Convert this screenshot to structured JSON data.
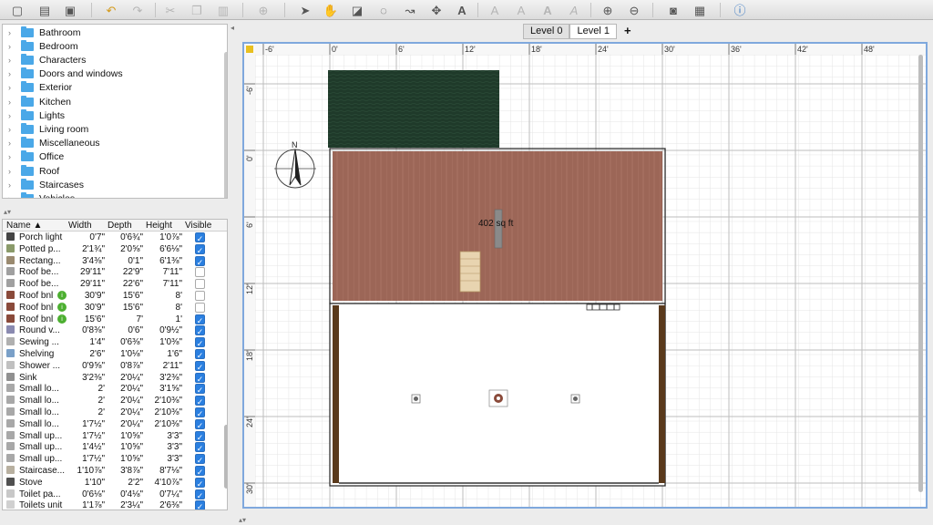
{
  "toolbar": {
    "icons": [
      "new-home-icon",
      "open-icon",
      "save-icon",
      "undo-icon",
      "redo-icon",
      "cut-icon",
      "copy-icon",
      "paste-icon",
      "add-furniture-icon",
      "select-icon",
      "pan-icon",
      "create-walls-icon",
      "create-rooms-icon",
      "create-polylines-icon",
      "create-dimensions-icon",
      "add-text-icon",
      "text-style-icons",
      "zoom-in-icon",
      "zoom-out-icon",
      "create-photo-icon",
      "create-video-icon",
      "help-icon"
    ]
  },
  "catalog": {
    "categories": [
      "Bathroom",
      "Bedroom",
      "Characters",
      "Doors and windows",
      "Exterior",
      "Kitchen",
      "Lights",
      "Living room",
      "Miscellaneous",
      "Office",
      "Roof",
      "Staircases",
      "Vehicles"
    ]
  },
  "furniture_table": {
    "headers": {
      "name": "Name ▲",
      "width": "Width",
      "depth": "Depth",
      "height": "Height",
      "visible": "Visible"
    },
    "rows": [
      {
        "name": "Porch light",
        "width": "0'7\"",
        "depth": "0'6¾\"",
        "height": "1'0⅞\"",
        "visible": true,
        "icon": "#444444"
      },
      {
        "name": "Potted p...",
        "width": "2'1¾\"",
        "depth": "2'0⅝\"",
        "height": "6'6⅛\"",
        "visible": true,
        "icon": "#8a9a6a"
      },
      {
        "name": "Rectang...",
        "width": "3'4⅜\"",
        "depth": "0'1\"",
        "height": "6'1⅜\"",
        "visible": true,
        "icon": "#9a8a70"
      },
      {
        "name": "Roof be...",
        "width": "29'11\"",
        "depth": "22'9\"",
        "height": "7'11\"",
        "visible": false,
        "icon": "#a0a0a0"
      },
      {
        "name": "Roof be...",
        "width": "29'11\"",
        "depth": "22'6\"",
        "height": "7'11\"",
        "visible": false,
        "icon": "#a0a0a0"
      },
      {
        "name": "Roof bnl",
        "width": "30'9\"",
        "depth": "15'6\"",
        "height": "8'",
        "visible": false,
        "icon": "#8a4a3a",
        "badge": true
      },
      {
        "name": "Roof bnl",
        "width": "30'9\"",
        "depth": "15'6\"",
        "height": "8'",
        "visible": false,
        "icon": "#8a4a3a",
        "badge": true
      },
      {
        "name": "Roof bnl",
        "width": "15'6\"",
        "depth": "7'",
        "height": "1'",
        "visible": true,
        "icon": "#8a4a3a",
        "badge": true
      },
      {
        "name": "Round v...",
        "width": "0'8⅜\"",
        "depth": "0'6\"",
        "height": "0'9½\"",
        "visible": true,
        "icon": "#8a8ab0"
      },
      {
        "name": "Sewing ...",
        "width": "1'4\"",
        "depth": "0'6⅜\"",
        "height": "1'0⅜\"",
        "visible": true,
        "icon": "#b0b0b0"
      },
      {
        "name": "Shelving",
        "width": "2'6\"",
        "depth": "1'0⅛\"",
        "height": "1'6\"",
        "visible": true,
        "icon": "#7aa0c8"
      },
      {
        "name": "Shower ...",
        "width": "0'9⅝\"",
        "depth": "0'8⅞\"",
        "height": "2'11\"",
        "visible": true,
        "icon": "#c0c0c0"
      },
      {
        "name": "Sink",
        "width": "3'2⅜\"",
        "depth": "2'0¼\"",
        "height": "3'2⅜\"",
        "visible": true,
        "icon": "#909090"
      },
      {
        "name": "Small lo...",
        "width": "2'",
        "depth": "2'0¼\"",
        "height": "3'1⅝\"",
        "visible": true,
        "icon": "#a8a8a8"
      },
      {
        "name": "Small lo...",
        "width": "2'",
        "depth": "2'0¼\"",
        "height": "2'10⅜\"",
        "visible": true,
        "icon": "#a8a8a8"
      },
      {
        "name": "Small lo...",
        "width": "2'",
        "depth": "2'0¼\"",
        "height": "2'10⅜\"",
        "visible": true,
        "icon": "#a8a8a8"
      },
      {
        "name": "Small lo...",
        "width": "1'7½\"",
        "depth": "2'0¼\"",
        "height": "2'10⅜\"",
        "visible": true,
        "icon": "#a8a8a8"
      },
      {
        "name": "Small up...",
        "width": "1'7½\"",
        "depth": "1'0⅝\"",
        "height": "3'3\"",
        "visible": true,
        "icon": "#a8a8a8"
      },
      {
        "name": "Small up...",
        "width": "1'4½\"",
        "depth": "1'0⅝\"",
        "height": "3'3\"",
        "visible": true,
        "icon": "#a8a8a8"
      },
      {
        "name": "Small up...",
        "width": "1'7½\"",
        "depth": "1'0⅝\"",
        "height": "3'3\"",
        "visible": true,
        "icon": "#a8a8a8"
      },
      {
        "name": "Staircase...",
        "width": "1'10⅞\"",
        "depth": "3'8⅞\"",
        "height": "8'7⅛\"",
        "visible": true,
        "icon": "#b8b0a0"
      },
      {
        "name": "Stove",
        "width": "1'10\"",
        "depth": "2'2\"",
        "height": "4'10⅞\"",
        "visible": true,
        "icon": "#505050"
      },
      {
        "name": "Toilet pa...",
        "width": "0'6⅛\"",
        "depth": "0'4⅛\"",
        "height": "0'7¼\"",
        "visible": true,
        "icon": "#c8c8c8"
      },
      {
        "name": "Toilets unit",
        "width": "1'1⅞\"",
        "depth": "2'3¼\"",
        "height": "2'6⅜\"",
        "visible": true,
        "icon": "#d0d0d0"
      }
    ]
  },
  "levels": {
    "tabs": [
      "Level 0",
      "Level 1"
    ],
    "selected": "Level 1",
    "add_label": "+"
  },
  "plan": {
    "ruler_x_labels": [
      "-6'",
      "0'",
      "6'",
      "12'",
      "18'",
      "24'",
      "30'",
      "36'",
      "42'",
      "48'"
    ],
    "ruler_y_labels": [
      "-6'",
      "0'",
      "6'",
      "12'",
      "18'",
      "24'",
      "30'"
    ],
    "room_area_label": "402 sq ft",
    "compass_label": "N",
    "colors": {
      "roof_green": "#1f3a2a",
      "roof_brick": "#9c6657",
      "wall_brown": "#5a3a1c",
      "selection_blue": "#7fa8dd"
    }
  }
}
